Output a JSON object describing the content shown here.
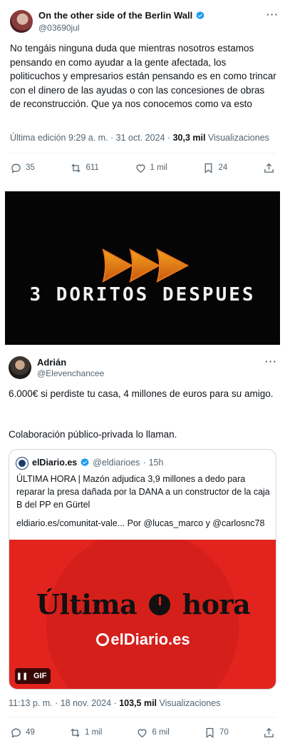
{
  "tweet1": {
    "display_name": "On the other side of the Berlin Wall",
    "handle": "@03690jul",
    "text": "No tengáis ninguna duda que mientras nosotros estamos pensando en como ayudar a la gente afectada, los politicuchos y empresarios están pensando es en como trincar con el dinero de las ayudas o con las concesiones de obras de reconstrucción. Que ya nos conocemos como va esto",
    "meta_prefix": "Última edición 9:29 a. m. · 31 oct. 2024 ·",
    "views_count": "30,3 mil",
    "views_label": "Visualizaciones",
    "actions": {
      "replies": "35",
      "reposts": "611",
      "likes": "1 mil",
      "bookmarks": "24"
    }
  },
  "meme": {
    "text": "3 DORITOS DESPUES"
  },
  "tweet2": {
    "display_name": "Adrián",
    "handle": "@Elevenchancee",
    "text_line1": "6.000€ si perdiste tu casa, 4 millones de euros para su amigo.",
    "text_line2": "Colaboración público-privada lo llaman.",
    "meta_prefix": "11:13 p. m. · 18 nov. 2024 ·",
    "views_count": "103,5 mil",
    "views_label": "Visualizaciones",
    "actions": {
      "replies": "49",
      "reposts": "1 mil",
      "likes": "6 mil",
      "bookmarks": "70"
    }
  },
  "quote": {
    "display_name": "elDiario.es",
    "handle": "@eldiarioes",
    "time": "15h",
    "text": "ÚLTIMA HORA | Mazón adjudica 3,9 millones a dedo para reparar la presa dañada por la DANA a un constructor de la caja B del PP en Gürtel",
    "link_text": "eldiario.es/comunitat-vale... Por @lucas_marco y @carlosnc78",
    "media": {
      "headline_left": "Última",
      "headline_right": "hora",
      "brand": "elDiario.es",
      "gif_label": "GIF"
    }
  },
  "colors": {
    "text": "#0f1419",
    "secondary": "#536471",
    "verified": "#1d9bf0",
    "media_red": "#e3231d"
  },
  "icons": [
    "verified-badge-icon",
    "more-icon",
    "reply-icon",
    "repost-icon",
    "like-icon",
    "bookmark-icon",
    "share-icon",
    "pause-icon"
  ]
}
